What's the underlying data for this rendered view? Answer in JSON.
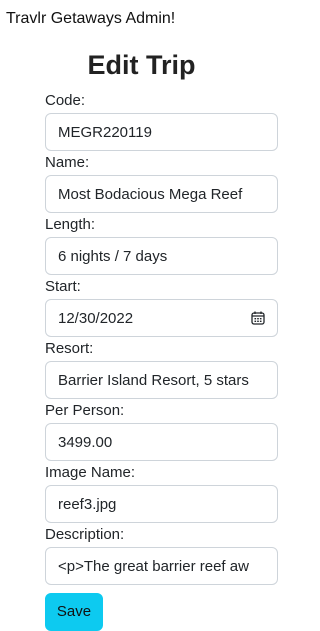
{
  "app": {
    "brand": "Travlr Getaways Admin!"
  },
  "page": {
    "title": "Edit Trip"
  },
  "form": {
    "fields": [
      {
        "label": "Code:",
        "value": "MEGR220119"
      },
      {
        "label": "Name:",
        "value": "Most Bodacious Mega Reef"
      },
      {
        "label": "Length:",
        "value": "6 nights / 7 days"
      },
      {
        "label": "Start:",
        "value": "12/30/2022",
        "icon": "calendar-icon"
      },
      {
        "label": "Resort:",
        "value": "Barrier Island Resort, 5 stars"
      },
      {
        "label": "Per Person:",
        "value": "3499.00"
      },
      {
        "label": "Image Name:",
        "value": "reef3.jpg"
      },
      {
        "label": "Description:",
        "value": "<p>The great barrier reef aw"
      }
    ],
    "save_label": "Save"
  },
  "colors": {
    "save_button": "#0dcaf0",
    "input_border": "#ced4da"
  }
}
